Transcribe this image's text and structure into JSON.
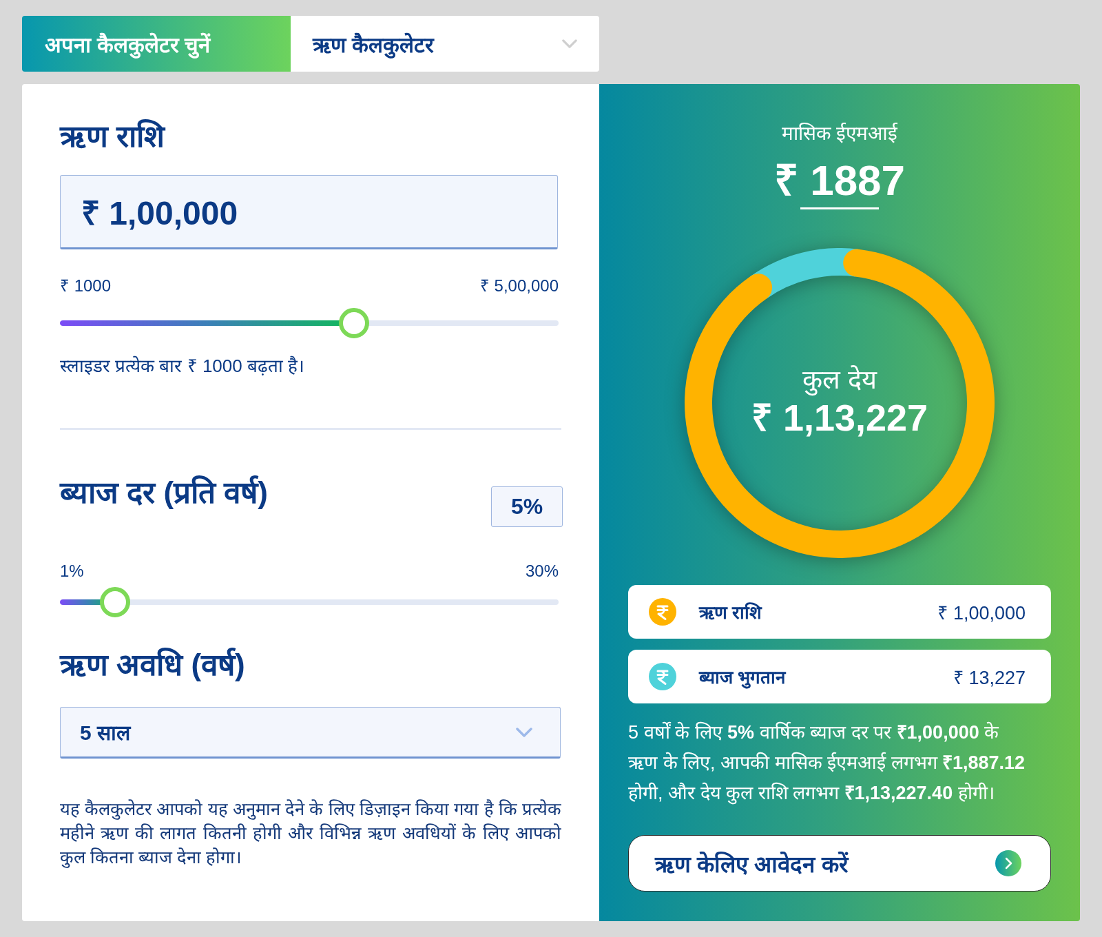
{
  "calculator_picker": {
    "label": "अपना कैलकुलेटर चुनें",
    "value": "ऋण कैलकुलेटर"
  },
  "loan_amount": {
    "title": "ऋण राशि",
    "value": "₹ 1,00,000",
    "min_label": "₹ 1000",
    "max_label": "₹ 5,00,000",
    "level": 0.59,
    "note": "स्लाइडर प्रत्येक बार ₹ 1000 बढ़ता है।"
  },
  "interest_rate": {
    "title": "ब्याज दर (प्रति वर्ष)",
    "value": "5%",
    "min_label": "1%",
    "max_label": "30%",
    "level": 0.11
  },
  "loan_tenure": {
    "title": "ऋण अवधि (वर्ष)",
    "value": "5 साल"
  },
  "description": "यह कैलकुलेटर आपको यह अनुमान देने के लिए डिज़ाइन किया गया है कि प्रत्येक महीने ऋण की लागत कितनी होगी और विभिन्न ऋण अवधियों के लिए आपको कुल कितना ब्याज देना होगा।",
  "result": {
    "emi_label": "मासिक ईएमआई",
    "emi_value": "₹ 1887",
    "donut": {
      "label": "कुल देय",
      "value": "₹ 1,13,227",
      "chart_data": {
        "type": "donut",
        "values": [
          88.3,
          11.7
        ]
      }
    },
    "breakdown": [
      {
        "label": "ऋण राशि",
        "value": "₹ 1,00,000",
        "color": "#ffb300"
      },
      {
        "label": "ब्याज भुगतान",
        "value": "₹ 13,227",
        "color": "#4fd2da"
      }
    ],
    "summary": "5 वर्षों के लिए **5%** वार्षिक ब्याज दर पर **₹1,00,000** के ऋण के लिए, आपकी मासिक ईएमआई लगभग **₹1,887.12** होगी, और देय कुल राशि लगभग **₹1,13,227.40** होगी।",
    "apply_button": "ऋण केलिए आवेदन करें"
  }
}
